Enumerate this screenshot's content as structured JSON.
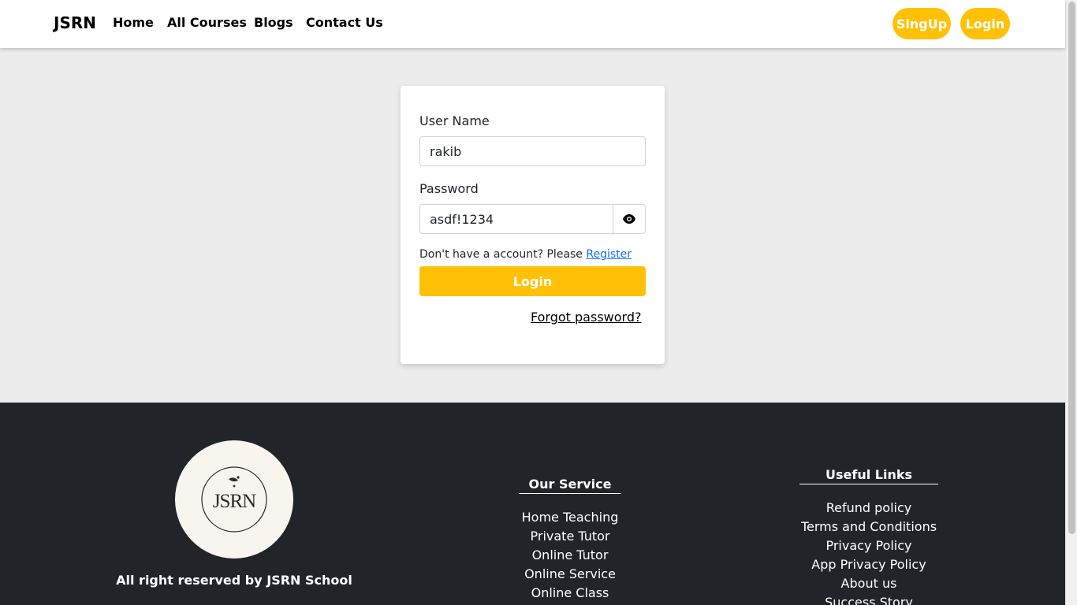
{
  "navbar": {
    "brand": "JSRN",
    "links": [
      "Home",
      "All Courses",
      "Blogs",
      "Contact Us"
    ],
    "signup_label": "SingUp",
    "login_label": "Login"
  },
  "login_form": {
    "username_label": "User Name",
    "username_value": "rakib",
    "password_label": "Password",
    "password_value": "asdf!1234",
    "register_prompt": "Don't have a account? Please",
    "register_link": "Register",
    "submit_label": "Login",
    "forgot_label": "Forgot password?"
  },
  "footer": {
    "logo_text": "JSRN",
    "copyright": "All right reserved by JSRN School",
    "service_title": "Our Service",
    "services": [
      "Home Teaching",
      "Private Tutor",
      "Online Tutor",
      "Online Service",
      "Online Class"
    ],
    "links_title": "Useful Links",
    "links": [
      "Refund policy",
      "Terms and Conditions",
      "Privacy Policy",
      "App Privacy Policy",
      "About us",
      "Success Story"
    ]
  },
  "colors": {
    "accent": "#ffc107",
    "footer_bg": "#212529",
    "page_bg": "#ececec"
  },
  "icons": {
    "password_toggle": "eye-icon"
  }
}
